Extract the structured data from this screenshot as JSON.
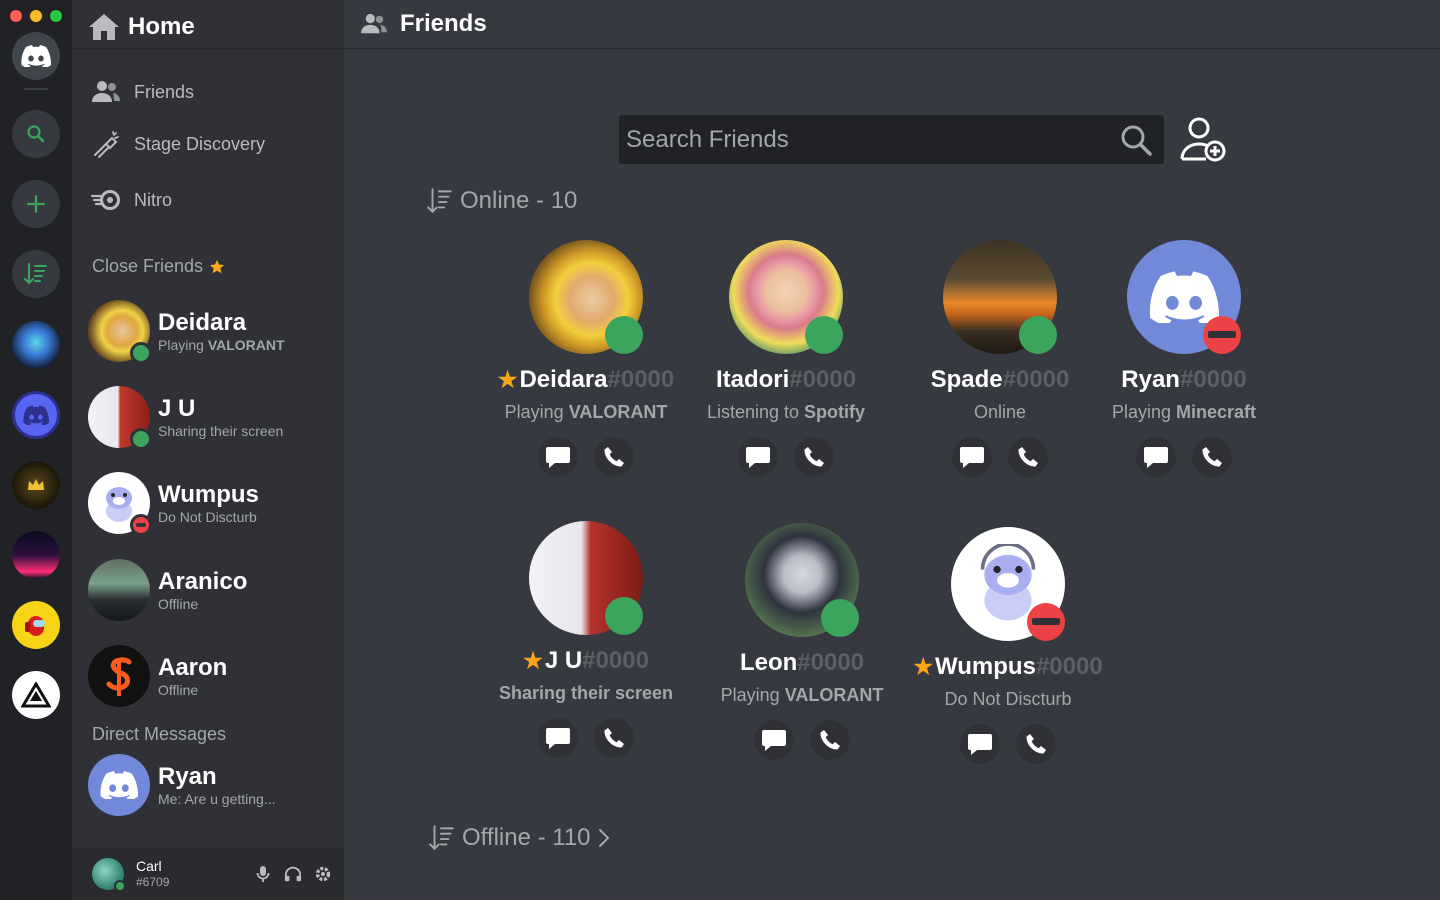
{
  "sidebar": {
    "home_title": "Home",
    "nav": [
      {
        "label": "Friends"
      },
      {
        "label": "Stage Discovery"
      },
      {
        "label": "Nitro"
      }
    ],
    "close_friends_label": "Close Friends",
    "close_friends": [
      {
        "name": "Deidara",
        "status_prefix": "Playing ",
        "status_bold": "VALORANT",
        "presence": "online"
      },
      {
        "name": "J U",
        "status_prefix": "Sharing their screen",
        "status_bold": "",
        "presence": "online"
      },
      {
        "name": "Wumpus",
        "status_prefix": "Do Not Discturb",
        "status_bold": "",
        "presence": "dnd"
      },
      {
        "name": "Aranico",
        "status_prefix": "Offline",
        "status_bold": "",
        "presence": "offline"
      },
      {
        "name": "Aaron",
        "status_prefix": "Offline",
        "status_bold": "",
        "presence": "offline"
      }
    ],
    "dm_label": "Direct Messages",
    "dms": [
      {
        "name": "Ryan",
        "preview": "Me: Are u getting..."
      }
    ],
    "user": {
      "name": "Carl",
      "tag": "#6709"
    }
  },
  "main": {
    "title": "Friends",
    "search_placeholder": "Search Friends",
    "online_label": "Online - 10",
    "offline_label": "Offline - 110",
    "friends": [
      {
        "name": "Deidara",
        "tag": "#0000",
        "starred": true,
        "activity_prefix": "Playing ",
        "activity_bold": "VALORANT",
        "presence": "online"
      },
      {
        "name": "Itadori",
        "tag": "#0000",
        "starred": false,
        "activity_prefix": "Listening to ",
        "activity_bold": "Spotify",
        "presence": "online"
      },
      {
        "name": "Spade",
        "tag": "#0000",
        "starred": false,
        "activity_prefix": "Online",
        "activity_bold": "",
        "presence": "online"
      },
      {
        "name": "Ryan",
        "tag": "#0000",
        "starred": false,
        "activity_prefix": "Playing ",
        "activity_bold": "Minecraft",
        "presence": "dnd"
      },
      {
        "name": "J U",
        "tag": "#0000",
        "starred": true,
        "activity_prefix": "Sharing their screen",
        "activity_bold": "",
        "presence": "online"
      },
      {
        "name": "Leon",
        "tag": "#0000",
        "starred": false,
        "activity_prefix": "Playing ",
        "activity_bold": "VALORANT",
        "presence": "online"
      },
      {
        "name": "Wumpus",
        "tag": "#0000",
        "starred": true,
        "activity_prefix": "Do Not Discturb",
        "activity_bold": "",
        "presence": "dnd"
      }
    ]
  },
  "colors": {
    "accent": "#5865f2",
    "green": "#3ba55d",
    "dnd": "#ed4245",
    "star": "#faa61a"
  }
}
